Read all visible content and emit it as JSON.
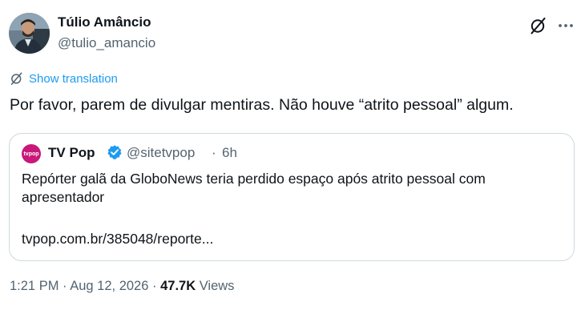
{
  "author": {
    "name": "Túlio Amâncio",
    "handle": "@tulio_amancio"
  },
  "translate": {
    "label": "Show translation"
  },
  "tweet": {
    "text": "Por favor, parem de divulgar mentiras. Não houve “atrito pessoal” algum."
  },
  "quote": {
    "avatar_text": "tvpop",
    "name": "TV Pop",
    "handle": "@sitetvpop",
    "separator": "·",
    "time": "6h",
    "text": "Repórter galã da GloboNews teria perdido espaço após atrito pessoal com apresentador",
    "link": "tvpop.com.br/385048/reporte..."
  },
  "meta": {
    "time": "1:21 PM",
    "sep1": "·",
    "date": "Aug 12, 2026",
    "sep2": "·",
    "views_count": "47.7K",
    "views_label": "Views"
  },
  "colors": {
    "accent": "#1d9bf0",
    "text": "#0f1419",
    "secondary": "#536471",
    "border": "#cfd9de",
    "tvpop_brand": "#c8187a"
  },
  "icons": [
    "grok-icon",
    "more-icon",
    "translate-icon",
    "verified-badge-icon"
  ]
}
